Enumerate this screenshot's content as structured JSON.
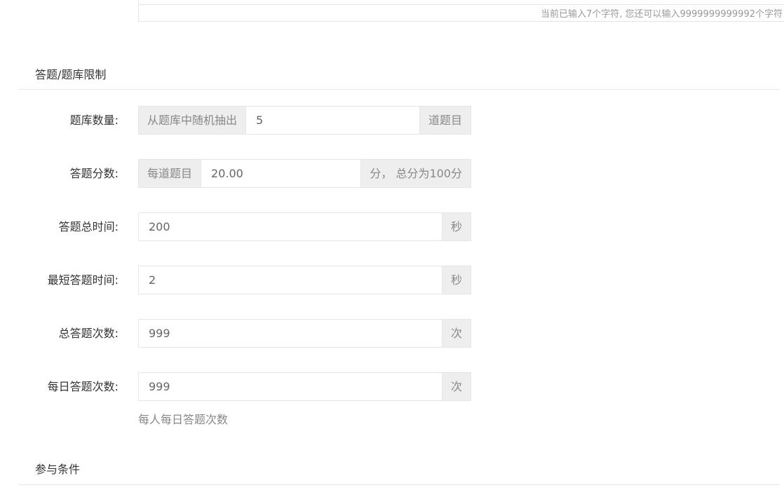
{
  "top": {
    "char_count": "当前已输入7个字符, 您还可以输入9999999999992个字符"
  },
  "sections": {
    "limits_title": "答题/题库限制",
    "conditions_title": "参与条件"
  },
  "form": {
    "bank_count": {
      "label": "题库数量:",
      "prefix": "从题库中随机抽出",
      "value": "5",
      "suffix": "道题目"
    },
    "score": {
      "label": "答题分数:",
      "prefix": "每道题目",
      "value": "20.00",
      "suffix": "分， 总分为100分"
    },
    "total_time": {
      "label": "答题总时间:",
      "value": "200",
      "suffix": "秒"
    },
    "min_time": {
      "label": "最短答题时间:",
      "value": "2",
      "suffix": "秒"
    },
    "total_attempts": {
      "label": "总答题次数:",
      "value": "999",
      "suffix": "次"
    },
    "daily_attempts": {
      "label": "每日答题次数:",
      "value": "999",
      "suffix": "次",
      "help": "每人每日答题次数"
    }
  }
}
